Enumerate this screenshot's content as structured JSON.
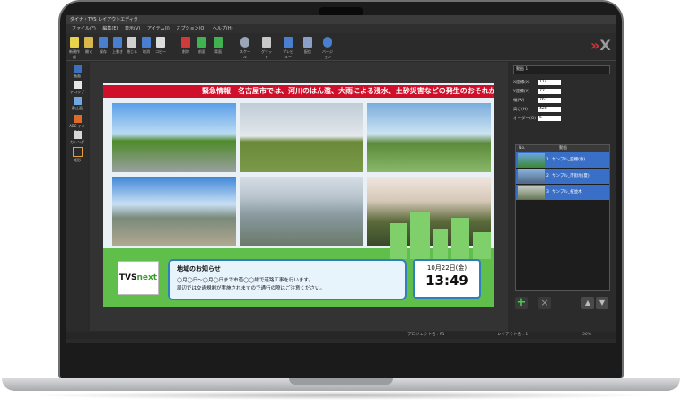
{
  "app": {
    "title": "ダイナ・TVS レイアウトエディタ",
    "menu": [
      "ファイル(F)",
      "編集(E)",
      "表示(V)",
      "アイテム(I)",
      "オプション(O)",
      "ヘルプ(H)"
    ],
    "toolbar": [
      "新規作成",
      "開く",
      "保存",
      "上書き",
      "閉じる",
      "取消",
      "コピー",
      "削除",
      "前面",
      "背面",
      "スケール",
      "グリッド",
      "プレビュー",
      "配信",
      "バージョン"
    ],
    "left_tools": [
      "画面",
      "テロップ",
      "静止画",
      "ABC テキスト",
      "カレンダー",
      "矩形"
    ]
  },
  "signage": {
    "ticker": "緊急情報　名古屋市では、河川のはん濫、大雨による浸水、土砂災害などの発生のおそれがあります",
    "logo_text": "TVS",
    "logo_accent": "next",
    "notice_title": "地域のお知らせ",
    "notice_line1": "◯月◯日～◯月◯日まで市道◯◯線で道路工事を行います。",
    "notice_line2": "周辺では交通規制が実施されますので通行の際はご注意ください。",
    "date": "10月22日(金)",
    "time": "13:49"
  },
  "panel": {
    "dropdown": "動画 1",
    "props": [
      {
        "label": "X座標(X)",
        "value": "114"
      },
      {
        "label": "Y座標(Y)",
        "value": "72"
      },
      {
        "label": "幅(W)",
        "value": "762"
      },
      {
        "label": "高さ(H)",
        "value": "428"
      },
      {
        "label": "オーダー(O)",
        "value": "5"
      }
    ],
    "list_header": [
      "No.",
      "動画"
    ],
    "list_items": [
      {
        "no": "1",
        "name": "サンプル_空撮(春)"
      },
      {
        "no": "2",
        "name": "サンプル_市街地(夏)"
      },
      {
        "no": "3",
        "name": "サンプル_桜並木"
      }
    ]
  },
  "status": {
    "project": "プロジェクト名 : P1",
    "layout": "レイアウト名 : 1",
    "zoom": "50%"
  },
  "colors": {
    "ticker": "#d0102a",
    "panel_accent": "#3a6fc8",
    "bottom_green": "#5fbf4a",
    "notice_border": "#2f7fc0"
  }
}
